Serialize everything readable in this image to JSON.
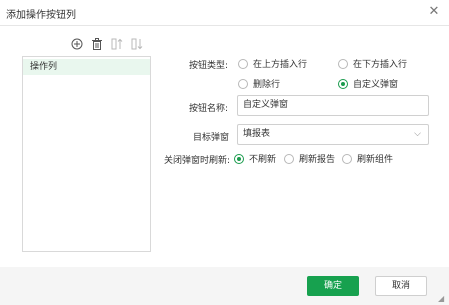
{
  "dialog": {
    "title": "添加操作按钮列",
    "close_icon": "close-icon"
  },
  "toolbar": {
    "icons": [
      "add-icon",
      "delete-icon",
      "move-up-icon",
      "move-down-icon"
    ]
  },
  "list": {
    "items": [
      {
        "label": "操作列",
        "selected": true
      }
    ]
  },
  "form": {
    "button_type_label": "按钮类型:",
    "button_type_options": [
      {
        "label": "在上方插入行",
        "checked": false
      },
      {
        "label": "在下方插入行",
        "checked": false
      },
      {
        "label": "删除行",
        "checked": false
      },
      {
        "label": "自定义弹窗",
        "checked": true
      }
    ],
    "button_name_label": "按钮名称:",
    "button_name_value": "自定义弹窗",
    "target_label": "目标弹窗",
    "target_value": "填报表",
    "refresh_label": "关闭弹窗时刷新:",
    "refresh_options": [
      {
        "label": "不刷新",
        "checked": true
      },
      {
        "label": "刷新报告",
        "checked": false
      },
      {
        "label": "刷新组件",
        "checked": false
      }
    ]
  },
  "footer": {
    "ok_label": "确定",
    "cancel_label": "取消"
  },
  "colors": {
    "accent": "#17a14f",
    "selected_row": "#e9f7ee"
  }
}
